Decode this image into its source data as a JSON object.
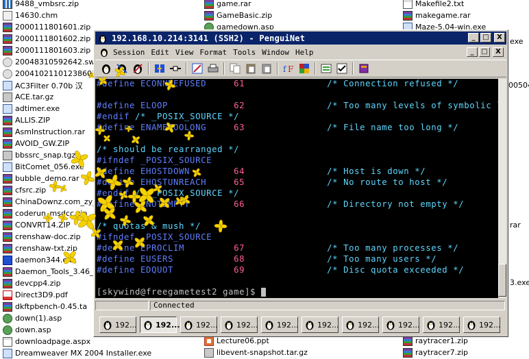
{
  "desktop": {
    "left_files": [
      {
        "name": "9488_vmbsrc.zip",
        "kind": "zip"
      },
      {
        "name": "14630.chm",
        "kind": "chm"
      },
      {
        "name": "2000111801601.zip",
        "kind": "rar"
      },
      {
        "name": "2000111801602.zip",
        "kind": "rar"
      },
      {
        "name": "2000111801603.zip",
        "kind": "rar"
      },
      {
        "name": "20048310592642.swf",
        "kind": "swf"
      },
      {
        "name": "20041021101238603.",
        "kind": "swf"
      },
      {
        "name": "AC3Filter 0.70b 汉",
        "kind": "exe"
      },
      {
        "name": "ACE.tar.gz",
        "kind": "gz"
      },
      {
        "name": "adtimer.exe",
        "kind": "exe"
      },
      {
        "name": "ALLIS.ZIP",
        "kind": "rar"
      },
      {
        "name": "AsmInstruction.rar",
        "kind": "rar"
      },
      {
        "name": "AVOID_GW.ZIP",
        "kind": "rar"
      },
      {
        "name": "bbssrc_snap.tgz",
        "kind": "tgz"
      },
      {
        "name": "BitComet_056.exe",
        "kind": "exe"
      },
      {
        "name": "bubble_demo.rar",
        "kind": "rar"
      },
      {
        "name": "cfsrc.zip",
        "kind": "rar"
      },
      {
        "name": "ChinaDownz.com_zy_",
        "kind": "rar"
      },
      {
        "name": "coderun_msdcc.zip",
        "kind": "rar"
      },
      {
        "name": "CONVRT14.ZIP",
        "kind": "rar"
      },
      {
        "name": "crenshaw-doc.zip",
        "kind": "rar"
      },
      {
        "name": "crenshaw-txt.zip",
        "kind": "rar"
      },
      {
        "name": "daemon344.exe",
        "kind": "daemon"
      },
      {
        "name": "Daemon_Tools_3.46_",
        "kind": "rar"
      },
      {
        "name": "devcpp4.zip",
        "kind": "rar"
      },
      {
        "name": "Direct3D9.pdf",
        "kind": "pdf"
      },
      {
        "name": "dkftpbench-0.45.ta",
        "kind": "rar"
      },
      {
        "name": "down(1).asp",
        "kind": "asp"
      },
      {
        "name": "down.asp",
        "kind": "asp"
      },
      {
        "name": "downloadpage.aspx",
        "kind": "txt"
      },
      {
        "name": "Dreamweaver MX 2004 Installer.exe",
        "kind": "exe"
      }
    ],
    "mid_files_top": [
      {
        "name": "game.rar",
        "kind": "rar"
      },
      {
        "name": "GameBasic.zip",
        "kind": "rar"
      },
      {
        "name": "gamedown.asp",
        "kind": "asp"
      }
    ],
    "mid_files_bottom": [
      {
        "name": "Lecture06.ppt",
        "kind": "ppt"
      },
      {
        "name": "libevent-snapshot.tar.gz",
        "kind": "gz"
      }
    ],
    "right_files_top": [
      {
        "name": "Makefile2.txt",
        "kind": "txt"
      },
      {
        "name": "makegame.rar",
        "kind": "rar"
      },
      {
        "name": "Maze-5.04-win.exe",
        "kind": "exe"
      }
    ],
    "right_files_bottom": [
      {
        "name": "raytracer1.zip",
        "kind": "rar"
      },
      {
        "name": "raytracer7.zip",
        "kind": "rar"
      }
    ],
    "right_edge_fragments": {
      "exe1": "exe",
      "num": "005040",
      "rar": "rar",
      "exe2": "3.exe"
    }
  },
  "window": {
    "title": "192.168.10.214:3141 (SSH2) - PenguiNet",
    "caption_buttons": {
      "minimize": "_",
      "maximize": "□",
      "close": "X"
    },
    "menu": [
      "Session",
      "Edit",
      "View",
      "Format",
      "Tools",
      "Window",
      "Help"
    ],
    "status": {
      "connection": "Connected"
    }
  },
  "terminal": {
    "lines": [
      [
        {
          "t": "#define ",
          "c": "kw"
        },
        {
          "t": "ECONNREFUSED     ",
          "c": "id"
        },
        {
          "t": "61",
          "c": "num"
        },
        {
          "t": "               /* Connection refused */",
          "c": "cm"
        }
      ],
      [],
      [
        {
          "t": "#define ",
          "c": "kw"
        },
        {
          "t": "ELOOP            ",
          "c": "id"
        },
        {
          "t": "62",
          "c": "num"
        },
        {
          "t": "               /* Too many levels of symbolic l",
          "c": "cm"
        }
      ],
      [
        {
          "t": "#endif ",
          "c": "kw"
        },
        {
          "t": "/* _POSIX_SOURCE */",
          "c": "cm"
        }
      ],
      [
        {
          "t": "#define ",
          "c": "kw"
        },
        {
          "t": "ENAMETOOLONG     ",
          "c": "id"
        },
        {
          "t": "63",
          "c": "num"
        },
        {
          "t": "               /* File name too long */",
          "c": "cm"
        }
      ],
      [],
      [
        {
          "t": "/* should be rearranged */",
          "c": "cm"
        }
      ],
      [
        {
          "t": "#ifndef ",
          "c": "kw"
        },
        {
          "t": "_POSIX_SOURCE",
          "c": "id"
        }
      ],
      [
        {
          "t": "#define ",
          "c": "kw"
        },
        {
          "t": "EHOSTDOWN        ",
          "c": "id"
        },
        {
          "t": "64",
          "c": "num"
        },
        {
          "t": "               /* Host is down */",
          "c": "cm"
        }
      ],
      [
        {
          "t": "#define ",
          "c": "kw"
        },
        {
          "t": "EHOSTUNREACH     ",
          "c": "id"
        },
        {
          "t": "65",
          "c": "num"
        },
        {
          "t": "               /* No route to host */",
          "c": "cm"
        }
      ],
      [
        {
          "t": "#endif ",
          "c": "kw"
        },
        {
          "t": "/* _POSIX_SOURCE */",
          "c": "cm"
        }
      ],
      [
        {
          "t": "#define ",
          "c": "kw"
        },
        {
          "t": "ENOTEMPTY        ",
          "c": "id"
        },
        {
          "t": "66",
          "c": "num"
        },
        {
          "t": "               /* Directory not empty */",
          "c": "cm"
        }
      ],
      [],
      [
        {
          "t": "/* quotas & mush */",
          "c": "cm"
        }
      ],
      [
        {
          "t": "#ifndef ",
          "c": "kw"
        },
        {
          "t": "_POSIX_SOURCE",
          "c": "id"
        }
      ],
      [
        {
          "t": "#define ",
          "c": "kw"
        },
        {
          "t": "EPROCLIM         ",
          "c": "id"
        },
        {
          "t": "67",
          "c": "num"
        },
        {
          "t": "               /* Too many processes */",
          "c": "cm"
        }
      ],
      [
        {
          "t": "#define ",
          "c": "kw"
        },
        {
          "t": "EUSERS           ",
          "c": "id"
        },
        {
          "t": "68",
          "c": "num"
        },
        {
          "t": "               /* Too many users */",
          "c": "cm"
        }
      ],
      [
        {
          "t": "#define ",
          "c": "kw"
        },
        {
          "t": "EDQUOT           ",
          "c": "id"
        },
        {
          "t": "69",
          "c": "num"
        },
        {
          "t": "               /* Disc quota exceeded */",
          "c": "cm"
        }
      ]
    ],
    "prompt": "[skywind@freegametest2 game]$ "
  },
  "session_tabs": [
    {
      "label": "192...",
      "active": false
    },
    {
      "label": "192...",
      "active": true
    },
    {
      "label": "192...",
      "active": false
    },
    {
      "label": "192...",
      "active": false
    },
    {
      "label": "192...",
      "active": false
    },
    {
      "label": "192...",
      "active": false
    },
    {
      "label": "192...",
      "active": false
    },
    {
      "label": "192...",
      "active": false
    },
    {
      "label": "192...",
      "active": false
    },
    {
      "label": "192...",
      "active": false
    }
  ],
  "colors": {
    "titlebar": "#0a246a",
    "terminal_bg": "#000000",
    "keyword": "#5f7fff",
    "number": "#ff5f8f",
    "comment": "#5fd7ff",
    "flower": "#f5d100"
  }
}
